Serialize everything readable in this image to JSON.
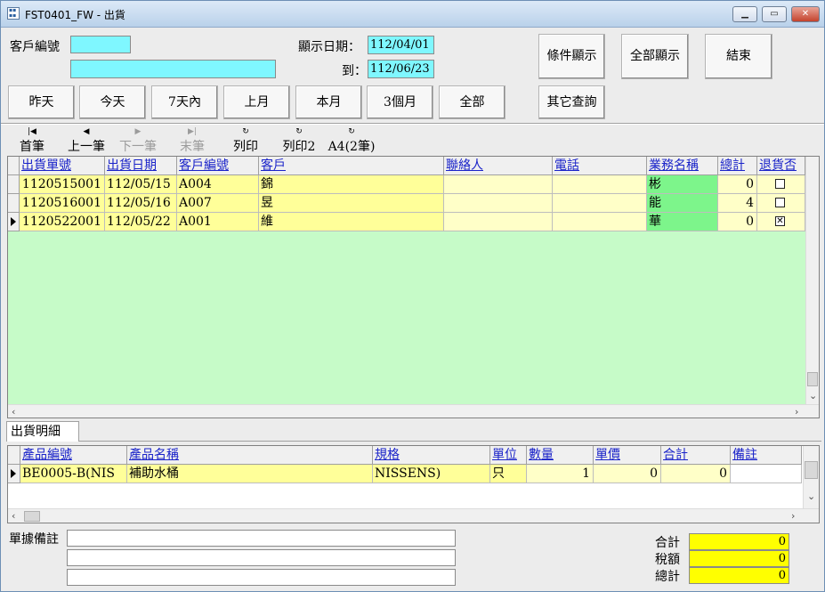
{
  "window": {
    "title": "FST0401_FW - 出貨",
    "icon": "app-icon",
    "min": "window-minimize-icon",
    "max": "window-maximize-icon",
    "close": "window-close-icon"
  },
  "filter": {
    "customer_code_label": "客戶編號",
    "customer_code_value": "",
    "customer_name_value": "",
    "date_label": "顯示日期：",
    "date_from": "112/04/01",
    "to_label": "到：",
    "date_to": "112/06/23"
  },
  "actions": {
    "filter_show": "條件顯示",
    "show_all": "全部顯示",
    "exit": "結束",
    "other_query": "其它查詢"
  },
  "quick_ranges": [
    "昨天",
    "今天",
    "7天內",
    "上月",
    "本月",
    "3個月",
    "全部"
  ],
  "nav": {
    "first": "首筆",
    "prev": "上一筆",
    "next": "下一筆",
    "last": "末筆",
    "print": "列印",
    "print2": "列印2",
    "a4": "A4(2筆)",
    "icons": {
      "first": "nav-first-icon",
      "prev": "nav-prev-icon",
      "next": "nav-next-icon",
      "last": "nav-last-icon",
      "print": "refresh-icon"
    }
  },
  "shipments": {
    "columns": [
      "出貨單號",
      "出貨日期",
      "客戶編號",
      "客戶",
      "聯絡人",
      "電話",
      "業務名稱",
      "總計",
      "退貨否"
    ],
    "rows": [
      {
        "no": "1120515001",
        "date": "112/05/15",
        "cust_code": "A004",
        "cust": "錦",
        "contact": "",
        "phone": "",
        "sales": "彬",
        "total": "0",
        "returned": false,
        "selected": false
      },
      {
        "no": "1120516001",
        "date": "112/05/16",
        "cust_code": "A007",
        "cust": "昱",
        "contact": "",
        "phone": "",
        "sales": "能",
        "total": "4",
        "returned": false,
        "selected": false
      },
      {
        "no": "1120522001",
        "date": "112/05/22",
        "cust_code": "A001",
        "cust": "維",
        "contact": "",
        "phone": "",
        "sales": "華",
        "total": "0",
        "returned": true,
        "selected": true
      }
    ]
  },
  "detail_tab": "出貨明細",
  "details": {
    "columns": [
      "產品編號",
      "產品名稱",
      "規格",
      "單位",
      "數量",
      "單價",
      "合計",
      "備註"
    ],
    "rows": [
      {
        "code": "BE0005-B(NIS",
        "name": "補助水桶",
        "spec": "NISSENS)",
        "unit": "只",
        "qty": "1",
        "price": "0",
        "amount": "0",
        "note": ""
      }
    ]
  },
  "memo": {
    "label": "單據備註",
    "lines": [
      "",
      "",
      ""
    ]
  },
  "totals": {
    "sum_label": "合計",
    "sum": "0",
    "tax_label": "稅額",
    "tax": "0",
    "grand_label": "總計",
    "grand": "0"
  },
  "colors": {
    "cyan": "#7ff7ff",
    "yellow": "#ffff99",
    "light_yellow": "#ffffc8",
    "green": "#7df58b",
    "grid_bg": "#c6fbc8",
    "total_yellow": "#ffff00",
    "header_text": "#1a23c9"
  }
}
